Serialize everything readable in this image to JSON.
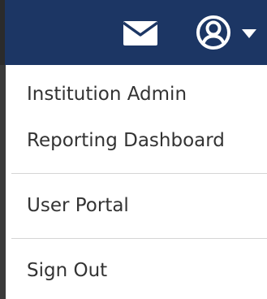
{
  "header": {
    "background_color": "#1c3664",
    "icon_color": "#ffffff",
    "mail_icon": "envelope-icon",
    "account_icon": "user-circle-icon",
    "dropdown_icon": "caret-down-icon"
  },
  "menu": {
    "items": [
      {
        "label": "Institution Admin"
      },
      {
        "label": "Reporting Dashboard"
      },
      {
        "label": "User Portal"
      },
      {
        "label": "Sign Out"
      }
    ],
    "text_color": "#333333",
    "divider_color": "#d6d6d6"
  }
}
